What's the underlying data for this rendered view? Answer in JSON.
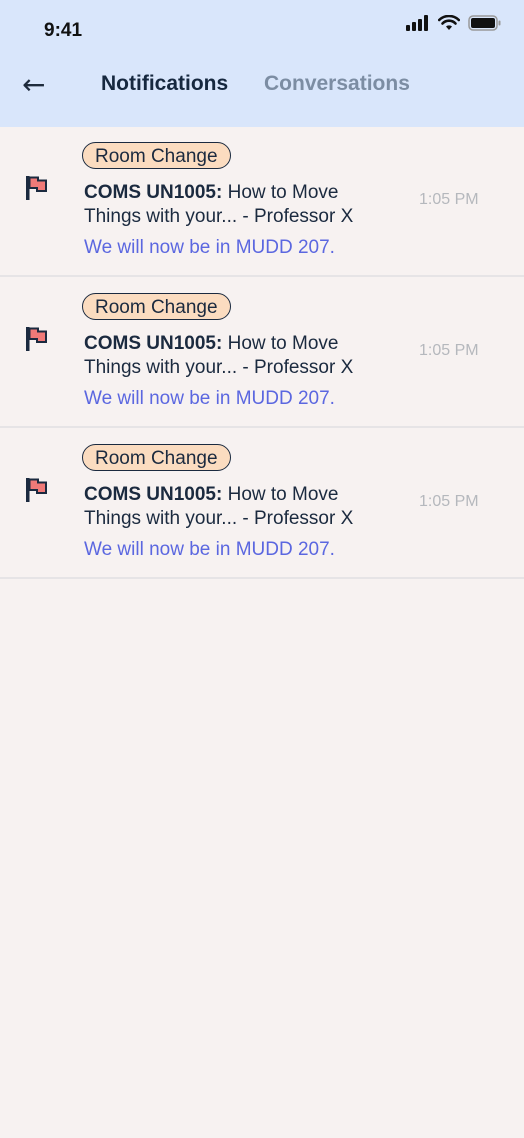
{
  "status_bar": {
    "time": "9:41",
    "icons": [
      "signal-icon",
      "wifi-icon",
      "battery-icon"
    ]
  },
  "header": {
    "back_icon": "back-arrow-icon",
    "back_glyph": "←",
    "tabs": [
      {
        "label": "Notifications",
        "active": true
      },
      {
        "label": "Conversations",
        "active": false
      }
    ]
  },
  "notifications": [
    {
      "badge": "Room Change",
      "code": "COMS UN1005:",
      "title_line1": " How to Move",
      "title_line2": "Things with your... - Professor X",
      "message": "We will now be in MUDD 207.",
      "time": "1:05 PM"
    },
    {
      "badge": "Room Change",
      "code": "COMS UN1005:",
      "title_line1": " How to Move",
      "title_line2": "Things with your... - Professor X",
      "message": "We will now be in MUDD 207.",
      "time": "1:05 PM"
    },
    {
      "badge": "Room Change",
      "code": "COMS UN1005:",
      "title_line1": " How to Move",
      "title_line2": "Things with your... - Professor X",
      "message": "We will now be in MUDD 207.",
      "time": "1:05 PM"
    }
  ],
  "colors": {
    "header_bg": "#d9e6fb",
    "page_bg": "#f7f2f1",
    "badge_bg": "#fbdcc0",
    "message_text": "#5b67e0",
    "flag": "#f07a78"
  }
}
